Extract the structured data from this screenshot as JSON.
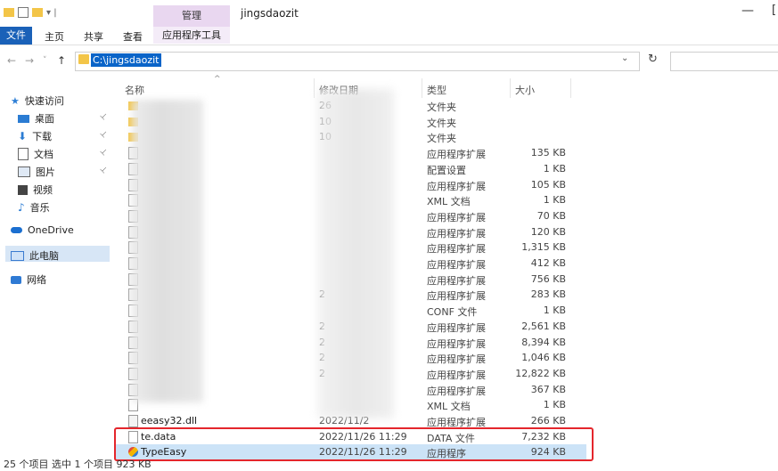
{
  "window": {
    "title": "jingsdaozit",
    "manage_tab": "管理",
    "minimize": "—",
    "maximize": "[",
    "qat_sep": "▾ |"
  },
  "ribbon": {
    "file": "文件",
    "home": "主页",
    "share": "共享",
    "view": "查看",
    "app_tools": "应用程序工具"
  },
  "nav": {
    "back": "←",
    "forward": "→",
    "recent": "˅",
    "up": "↑",
    "address": "C:\\jingsdaozit",
    "dropdown": "⌄",
    "refresh": "↻"
  },
  "sidebar": {
    "quick_access": "快速访问",
    "items": [
      {
        "label": "桌面",
        "pinned": true
      },
      {
        "label": "下载",
        "pinned": true
      },
      {
        "label": "文档",
        "pinned": true
      },
      {
        "label": "图片",
        "pinned": true
      },
      {
        "label": "视频",
        "pinned": false
      },
      {
        "label": "音乐",
        "pinned": false
      }
    ],
    "onedrive": "OneDrive",
    "this_pc": "此电脑",
    "network": "网络",
    "pin_glyph": "📌"
  },
  "columns": {
    "name": "名称",
    "date": "修改日期",
    "type": "类型",
    "size": "大小",
    "sort_glyph": "^"
  },
  "files": [
    {
      "name": "",
      "date": "26",
      "type": "文件夹",
      "size": "",
      "icon": "folder"
    },
    {
      "name": "",
      "date": "10",
      "type": "文件夹",
      "size": "",
      "icon": "folder"
    },
    {
      "name": "",
      "date": "10",
      "type": "文件夹",
      "size": "",
      "icon": "folder"
    },
    {
      "name": "",
      "date": "",
      "type": "应用程序扩展",
      "size": "135 KB",
      "icon": "dll"
    },
    {
      "name": "",
      "date": "",
      "type": "配置设置",
      "size": "1 KB",
      "icon": "gear"
    },
    {
      "name": "",
      "date": "",
      "type": "应用程序扩展",
      "size": "105 KB",
      "icon": "dll"
    },
    {
      "name": "",
      "date": "",
      "type": "XML 文档",
      "size": "1 KB",
      "icon": "doc"
    },
    {
      "name": "",
      "date": "",
      "type": "应用程序扩展",
      "size": "70 KB",
      "icon": "dll"
    },
    {
      "name": "",
      "date": "",
      "type": "应用程序扩展",
      "size": "120 KB",
      "icon": "dll"
    },
    {
      "name": "",
      "date": "",
      "type": "应用程序扩展",
      "size": "1,315 KB",
      "icon": "dll"
    },
    {
      "name": "",
      "date": "",
      "type": "应用程序扩展",
      "size": "412 KB",
      "icon": "dll"
    },
    {
      "name": "",
      "date": "",
      "type": "应用程序扩展",
      "size": "756 KB",
      "icon": "dll"
    },
    {
      "name": "",
      "date": "2",
      "type": "应用程序扩展",
      "size": "283 KB",
      "icon": "dll"
    },
    {
      "name": "",
      "date": "",
      "type": "CONF 文件",
      "size": "1 KB",
      "icon": "doc"
    },
    {
      "name": "",
      "date": "2",
      "type": "应用程序扩展",
      "size": "2,561 KB",
      "icon": "dll"
    },
    {
      "name": "",
      "date": "2",
      "type": "应用程序扩展",
      "size": "8,394 KB",
      "icon": "dll"
    },
    {
      "name": "",
      "date": "2",
      "type": "应用程序扩展",
      "size": "1,046 KB",
      "icon": "dll"
    },
    {
      "name": "",
      "date": "2",
      "type": "应用程序扩展",
      "size": "12,822 KB",
      "icon": "dll"
    },
    {
      "name": "",
      "date": "",
      "type": "应用程序扩展",
      "size": "367 KB",
      "icon": "dll"
    },
    {
      "name": "",
      "date": "",
      "type": "XML 文档",
      "size": "1 KB",
      "icon": "doc"
    },
    {
      "name": "eeasy32.dll",
      "date": "2022/11/2",
      "type": "应用程序扩展",
      "size": "266 KB",
      "icon": "dll"
    },
    {
      "name": "te.data",
      "date": "2022/11/26 11:29",
      "type": "DATA 文件",
      "size": "7,232 KB",
      "icon": "doc"
    },
    {
      "name": "TypeEasy",
      "date": "2022/11/26 11:29",
      "type": "应用程序",
      "size": "924 KB",
      "icon": "app",
      "selected": true
    }
  ],
  "status": "25 个项目    选中 1 个项目  923 KB",
  "colors": {
    "accent": "#1a61b8",
    "manage": "#e9d7f0",
    "selection": "#cce3f7",
    "highlight": "#e4262c"
  }
}
